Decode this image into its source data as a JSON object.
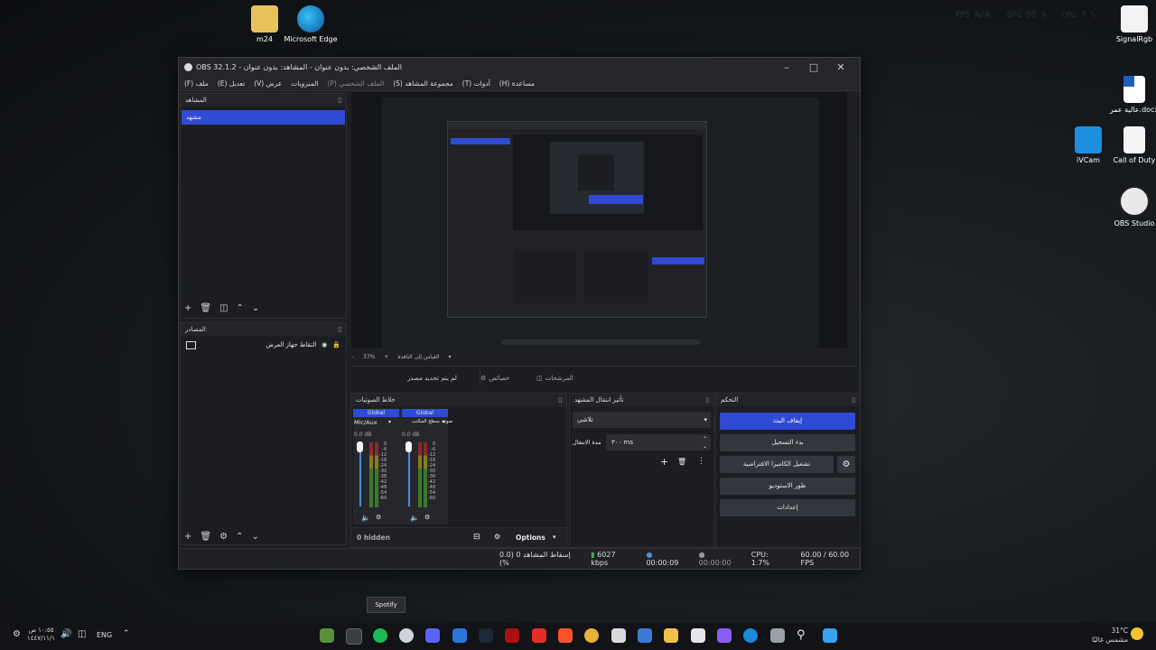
{
  "desktop": {
    "icons": [
      {
        "label": "m24"
      },
      {
        "label": "Microsoft Edge"
      },
      {
        "label": "SignalRgb"
      },
      {
        "label": "عالية عمر.docx"
      },
      {
        "label": "iVCam"
      },
      {
        "label": "Call of Duty"
      },
      {
        "label": "OBS Studio"
      }
    ],
    "hud": {
      "fps_label": "FPS",
      "fps_value": "N/A",
      "gpu_label": "GPU",
      "gpu_value": "99 %",
      "cpu_label": "CPU",
      "cpu_value": "7 %"
    }
  },
  "window": {
    "title": "OBS 32.1.2 - الملف الشخصي: بدون عنوان - المشاهد: بدون عنوان",
    "menu": [
      "(F) ملف",
      "(E) تعديل",
      "(V) عرض",
      "المنزويات",
      "(P) الملف الشخصي",
      "(S) مجموعة المشاهد",
      "(T) أدوات",
      "(H) مساعدة"
    ]
  },
  "scenes": {
    "title": "المشاهد",
    "items": [
      "مشهد"
    ]
  },
  "sources": {
    "title": "المصادر",
    "items": [
      {
        "label": "التقاط جهاز العرض"
      }
    ]
  },
  "preview": {
    "zoom": "37%",
    "canvas_label": "القياس إلى النافذة",
    "no_source": "لم يتم تحديد مصدر",
    "properties": "خصائص",
    "filters": "المرشحات"
  },
  "audio": {
    "title": "خلاط الصوتيات",
    "channels": [
      {
        "badge": "Global",
        "name": "Mic/Aux",
        "db": "0.0 dB"
      },
      {
        "badge": "Global",
        "name": "صوت سطح المكتب",
        "db": "0.0 dB"
      }
    ],
    "scale": [
      "0",
      "-6",
      "-12",
      "-18",
      "-24",
      "-30",
      "-36",
      "-42",
      "-48",
      "-54",
      "-60"
    ],
    "hidden": "0 hidden",
    "options": "Options"
  },
  "transitions": {
    "title": "تأثير انتقال المشهد",
    "type": "تلاشي",
    "duration_label": "مدة الانتقال",
    "duration_value": "٣٠٠ ms"
  },
  "controls": {
    "title": "التحكم",
    "buttons": [
      "إيقاف البث",
      "بدء التسجيل",
      "تشغيل الكاميرا الافتراضية",
      "طور الاستوديو",
      "إعدادات"
    ]
  },
  "status": {
    "dropped": "إسقاط المشاهد 0 (0.0 %)",
    "bitrate": "6027 kbps",
    "stream_time": "00:00:09",
    "rec_time": "00:00:00",
    "cpu": "CPU: 1.7%",
    "fps": "60.00 / 60.00 FPS"
  },
  "taskbar": {
    "time": "١٠:٥٥ ص",
    "date": "١٤٤٧/١١/١",
    "lang": "ENG",
    "weather_temp": "31°C",
    "weather_desc": "مشمس غالبًا",
    "tooltip": "Spotify"
  },
  "colors": {
    "accent": "#2f4bd3",
    "bg": "#1e1f23"
  }
}
